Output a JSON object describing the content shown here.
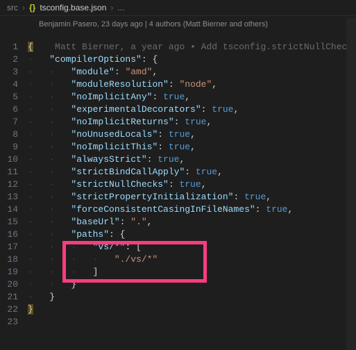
{
  "breadcrumb": {
    "root": "src",
    "file": "tsconfig.base.json",
    "trail": "..."
  },
  "blame": "Benjamin Pasero, 23 days ago | 4 authors (Matt Bierner and others)",
  "inline_annotation": "Matt Bierner, a year ago • Add tsconfig.strictNullChecks",
  "lines": {
    "l1": "{",
    "l2": "\"compilerOptions\"",
    "l2b": ": {",
    "l3k": "\"module\"",
    "l3v": "\"amd\"",
    "l4k": "\"moduleResolution\"",
    "l4v": "\"node\"",
    "l5k": "\"noImplicitAny\"",
    "l5v": "true",
    "l6k": "\"experimentalDecorators\"",
    "l6v": "true",
    "l7k": "\"noImplicitReturns\"",
    "l7v": "true",
    "l8k": "\"noUnusedLocals\"",
    "l8v": "true",
    "l9k": "\"noImplicitThis\"",
    "l9v": "true",
    "l10k": "\"alwaysStrict\"",
    "l10v": "true",
    "l11k": "\"strictBindCallApply\"",
    "l11v": "true",
    "l12k": "\"strictNullChecks\"",
    "l12v": "true",
    "l13k": "\"strictPropertyInitialization\"",
    "l13v": "true",
    "l14k": "\"forceConsistentCasingInFileNames\"",
    "l14v": "true",
    "l15k": "\"baseUrl\"",
    "l15v": "\".\"",
    "l16k": "\"paths\"",
    "l16b": ": {",
    "l17k": "\"vs/*\"",
    "l17b": ": [",
    "l18v": "\"./vs/*\"",
    "l19": "]",
    "l20": "}",
    "l21": "}",
    "l22": "}"
  },
  "gutter": [
    "1",
    "2",
    "3",
    "4",
    "5",
    "6",
    "7",
    "8",
    "9",
    "10",
    "11",
    "12",
    "13",
    "14",
    "15",
    "16",
    "17",
    "18",
    "19",
    "20",
    "21",
    "22",
    "23"
  ]
}
